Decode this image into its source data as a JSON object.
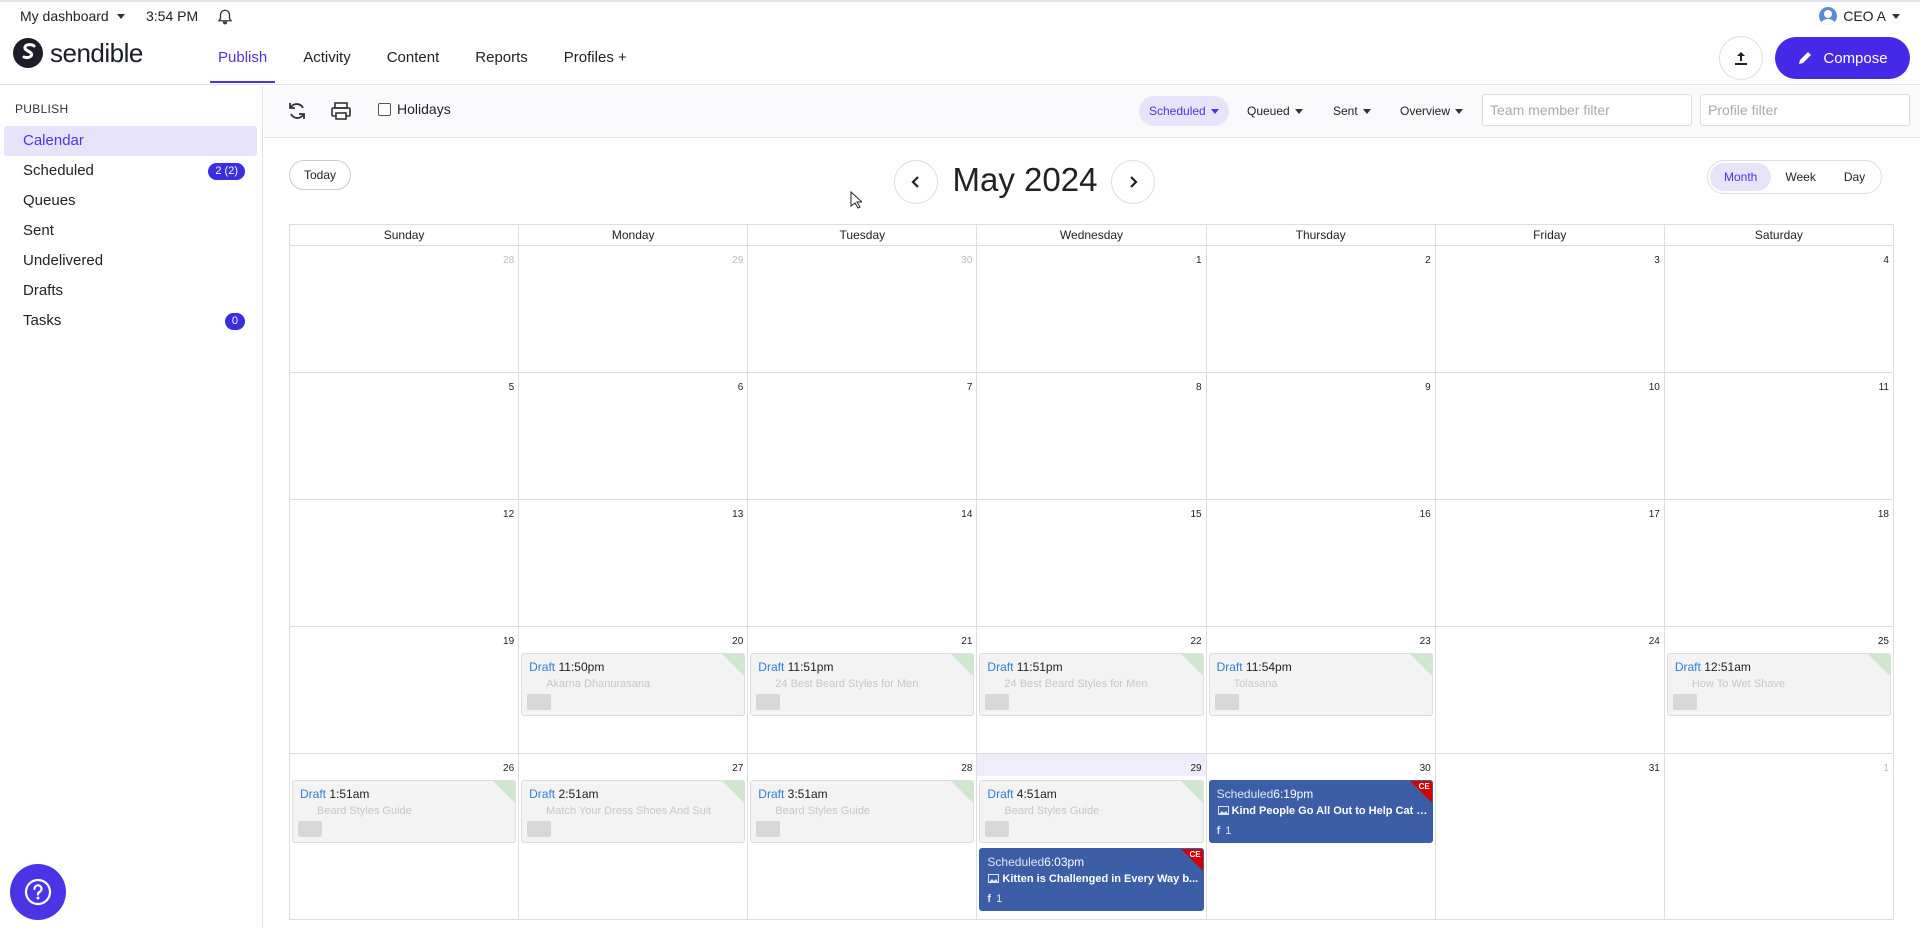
{
  "topbar": {
    "dashboard_label": "My dashboard",
    "time": "3:54 PM",
    "user_name": "CEO A"
  },
  "brand": {
    "name": "sendible"
  },
  "nav": {
    "items": [
      {
        "label": "Publish",
        "active": true
      },
      {
        "label": "Activity"
      },
      {
        "label": "Content"
      },
      {
        "label": "Reports"
      },
      {
        "label": "Profiles +"
      }
    ],
    "compose_label": "Compose"
  },
  "sidebar": {
    "heading": "PUBLISH",
    "items": [
      {
        "label": "Calendar",
        "active": true
      },
      {
        "label": "Scheduled",
        "badge": "2 (2)"
      },
      {
        "label": "Queues"
      },
      {
        "label": "Sent"
      },
      {
        "label": "Undelivered"
      },
      {
        "label": "Drafts"
      },
      {
        "label": "Tasks",
        "badge": "0"
      }
    ]
  },
  "toolbar": {
    "holidays_label": "Holidays",
    "filters": [
      {
        "label": "Scheduled",
        "active": true
      },
      {
        "label": "Queued"
      },
      {
        "label": "Sent"
      },
      {
        "label": "Overview"
      }
    ],
    "team_filter_placeholder": "Team member filter",
    "profile_filter_placeholder": "Profile filter"
  },
  "calendar": {
    "today_label": "Today",
    "title": "May 2024",
    "views": [
      {
        "label": "Month",
        "active": true
      },
      {
        "label": "Week"
      },
      {
        "label": "Day"
      }
    ],
    "weekdays": [
      "Sunday",
      "Monday",
      "Tuesday",
      "Wednesday",
      "Thursday",
      "Friday",
      "Saturday"
    ],
    "weeks": [
      [
        "28",
        "29",
        "30",
        "1",
        "2",
        "3",
        "4"
      ],
      [
        "5",
        "6",
        "7",
        "8",
        "9",
        "10",
        "11"
      ],
      [
        "12",
        "13",
        "14",
        "15",
        "16",
        "17",
        "18"
      ],
      [
        "19",
        "20",
        "21",
        "22",
        "23",
        "24",
        "25"
      ],
      [
        "26",
        "27",
        "28",
        "29",
        "30",
        "31",
        "1"
      ]
    ],
    "events": {
      "w3": [
        null,
        {
          "status": "Draft",
          "time": "11:50pm",
          "title": "Akarna Dhanurasana"
        },
        {
          "status": "Draft",
          "time": "11:51pm",
          "title": "24 Best Beard Styles for Men"
        },
        {
          "status": "Draft",
          "time": "11:51pm",
          "title": "24 Best Beard Styles for Men"
        },
        {
          "status": "Draft",
          "time": "11:54pm",
          "title": "Tolasana"
        },
        null,
        {
          "status": "Draft",
          "time": "12:51am",
          "title": "How To Wet Shave"
        }
      ],
      "w4": [
        {
          "status": "Draft",
          "time": "1:51am",
          "title": "Beard Styles Guide"
        },
        {
          "status": "Draft",
          "time": "2:51am",
          "title": "Match Your Dress Shoes And Suit"
        },
        {
          "status": "Draft",
          "time": "3:51am",
          "title": "Beard Styles Guide"
        },
        {
          "status": "Draft",
          "time": "4:51am",
          "title": "Beard Styles Guide"
        },
        null,
        null,
        null
      ],
      "sched_wed": {
        "status": "Scheduled",
        "time": "6:03pm",
        "title": "Kitten is Challenged in Every Way b...",
        "count": "1",
        "corner": "CE"
      },
      "sched_thu": {
        "status": "Scheduled",
        "time": "6:19pm",
        "title": "Kind People Go All Out to Help Cat L...",
        "count": "1",
        "corner": "CE"
      }
    }
  },
  "colors": {
    "accent": "#4a36e0",
    "compose_bg": "#4628e8",
    "scheduled_event": "#3c5ea6"
  }
}
